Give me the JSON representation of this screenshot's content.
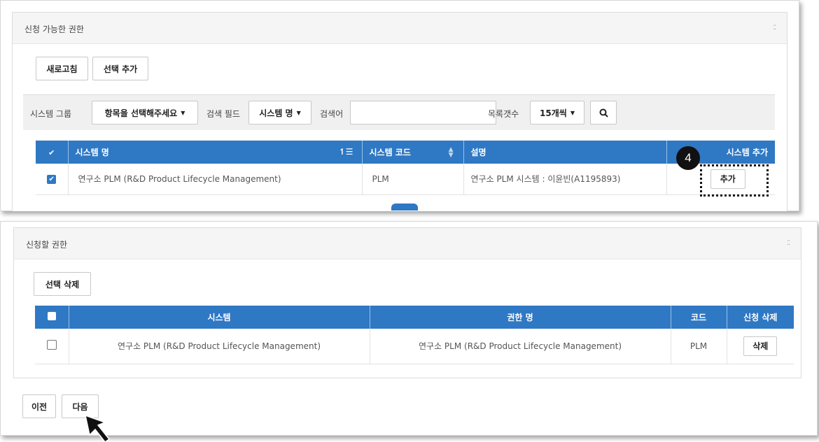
{
  "available": {
    "title": "신청 가능한 권한",
    "refresh_label": "새로고침",
    "add_selected_label": "선택 추가",
    "filters": {
      "system_group_label": "시스템 그룹",
      "system_group_value": "항목을 선택해주세요",
      "search_field_label": "검색 필드",
      "search_field_value": "시스템 명",
      "keyword_label": "검색어",
      "keyword_value": "",
      "page_size_label": "목록갯수",
      "page_size_value": "15개씩"
    },
    "columns": [
      "시스템 명",
      "시스템 코드",
      "설명",
      "시스템 추가"
    ],
    "rows": [
      {
        "checked": true,
        "name": "연구소 PLM (R&D Product Lifecycle Management)",
        "code": "PLM",
        "desc": "연구소 PLM 시스템 : 이윤빈(A1195893)",
        "action": "추가"
      }
    ]
  },
  "requested": {
    "title": "신청할 권한",
    "delete_selected_label": "선택 삭제",
    "columns": [
      "시스템",
      "권한 명",
      "코드",
      "신청 삭제"
    ],
    "rows": [
      {
        "checked": false,
        "system": "연구소 PLM (R&D Product Lifecycle Management)",
        "permission": "연구소 PLM (R&D Product Lifecycle Management)",
        "code": "PLM",
        "action": "삭제"
      }
    ]
  },
  "nav": {
    "prev_label": "이전",
    "next_label": "다음"
  },
  "annotation": {
    "step_number": "4"
  },
  "colors": {
    "header_blue": "#2f78c4",
    "panel_bg": "#f5f5f5"
  },
  "icons": [
    "checkbox-icon",
    "sort-icon",
    "sort-arrows-icon",
    "search-icon",
    "expand-icon",
    "cursor-arrow-icon"
  ]
}
